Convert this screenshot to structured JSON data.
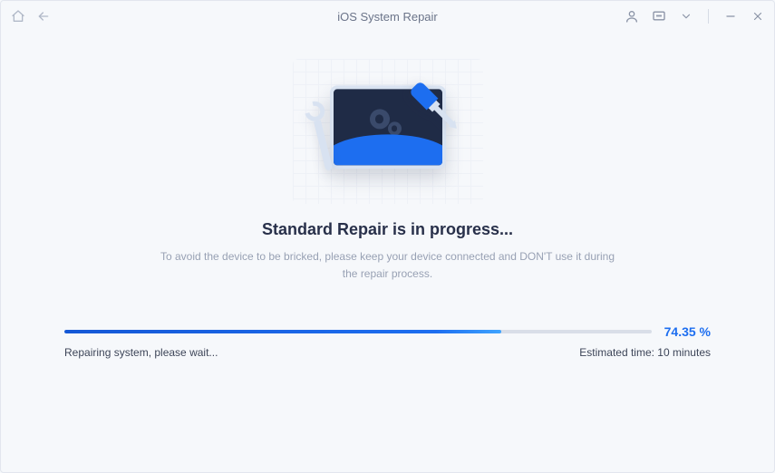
{
  "window": {
    "title": "iOS System Repair"
  },
  "main": {
    "heading": "Standard Repair is in progress...",
    "subtitle": "To avoid the device to be bricked, please keep your device connected and DON'T use it during the repair process."
  },
  "progress": {
    "percent_value": 74.35,
    "percent_label": "74.35 %",
    "status_text": "Repairing system, please wait...",
    "estimated_label": "Estimated time: 10 minutes",
    "fill_width": "74.35%"
  },
  "colors": {
    "accent": "#1d6ef0"
  }
}
